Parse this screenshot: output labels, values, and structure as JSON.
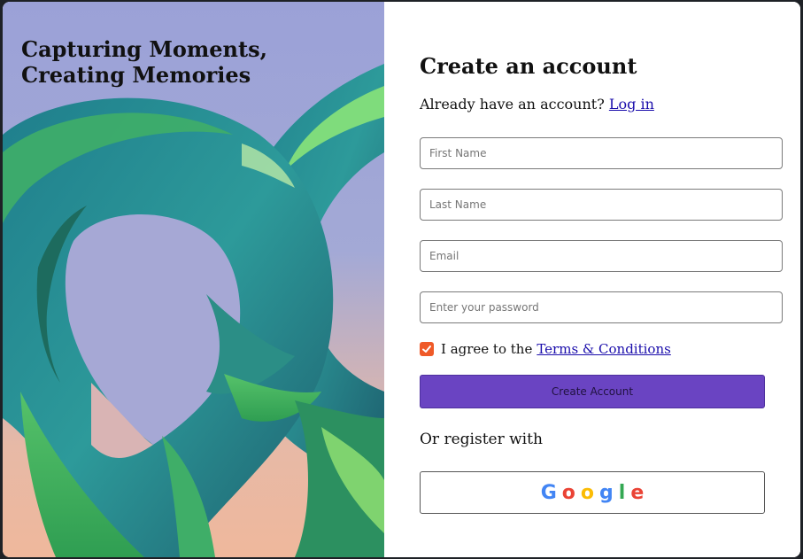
{
  "hero": {
    "title_line1": "Capturing Moments,",
    "title_line2": "Creating Memories"
  },
  "form": {
    "title": "Create an account",
    "login_prompt": "Already have an account?",
    "login_link": "Log in",
    "fields": {
      "first_name_placeholder": "First Name",
      "last_name_placeholder": "Last Name",
      "email_placeholder": "Email",
      "password_placeholder": "Enter your password"
    },
    "agree_text": "I agree to the",
    "terms_link": "Terms & Conditions",
    "terms_checked": true,
    "submit_label": "Create Account",
    "alt_register_text": "Or register with",
    "google_letters": [
      "G",
      "o",
      "o",
      "g",
      "l",
      "e"
    ]
  },
  "colors": {
    "primary_button": "#6a44c2",
    "checkbox": "#ef5a28",
    "link": "#1a0dab"
  },
  "icons": {
    "checkbox": "checkmark-icon",
    "google": "google-logo-icon"
  }
}
